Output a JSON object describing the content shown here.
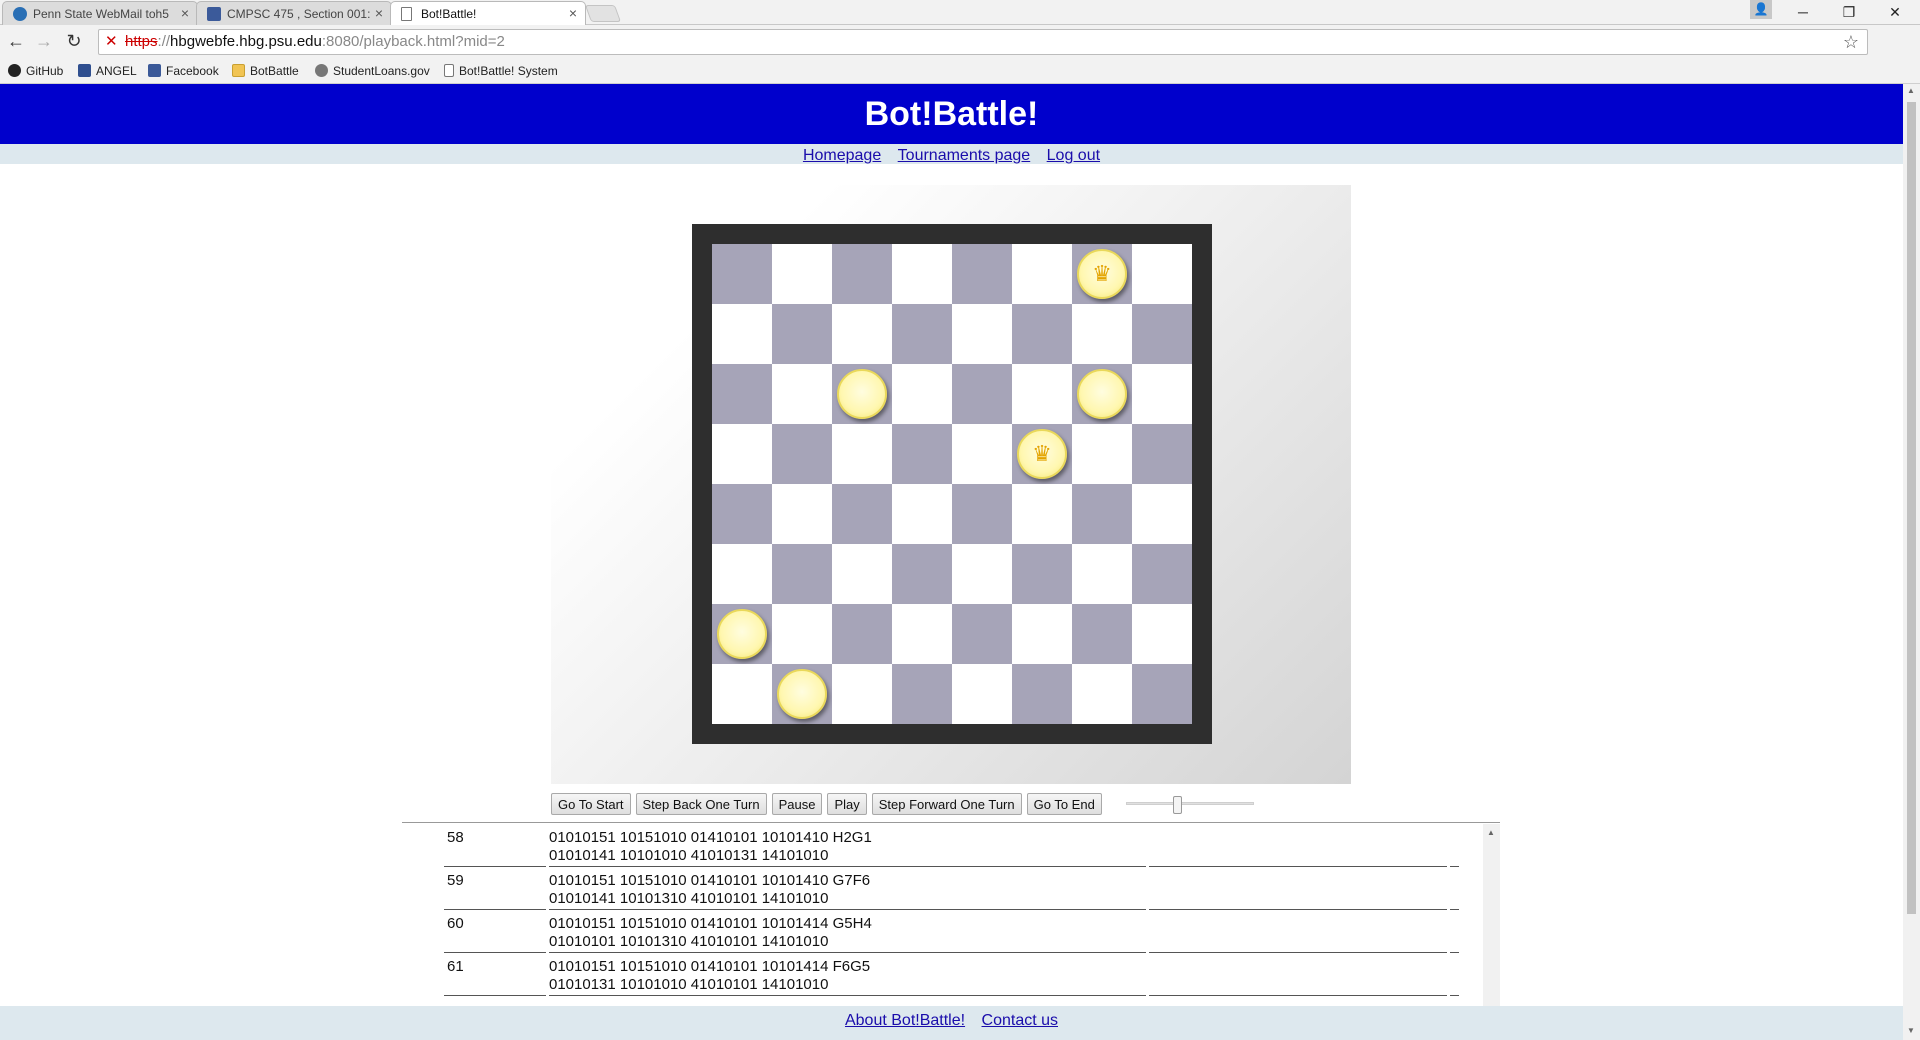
{
  "browser": {
    "tabs": [
      {
        "title": "Penn State WebMail toh5",
        "close": "×"
      },
      {
        "title": "CMPSC 475 , Section 001:",
        "close": "×"
      },
      {
        "title": "Bot!Battle!",
        "close": "×"
      }
    ],
    "url": {
      "scheme": "https",
      "host": "hbgwebfe.hbg.psu.edu",
      "rest": ":8080/playback.html?mid=2"
    },
    "bookmarks": [
      "GitHub",
      "ANGEL",
      "Facebook",
      "BotBattle",
      "StudentLoans.gov",
      "Bot!Battle! System"
    ],
    "nav": {
      "back": "←",
      "forward": "→",
      "reload": "↻",
      "star": "☆",
      "menu": "≡",
      "insecure": "✕"
    },
    "window": {
      "minimize": "─",
      "restore": "❐",
      "close": "✕",
      "profile": "👤"
    }
  },
  "site": {
    "title": "Bot!Battle!",
    "links": [
      "Homepage",
      "Tournaments page",
      "Log out"
    ]
  },
  "board": {
    "pieces": [
      {
        "row": 0,
        "col": 6,
        "king": true
      },
      {
        "row": 2,
        "col": 2,
        "king": false
      },
      {
        "row": 2,
        "col": 6,
        "king": false
      },
      {
        "row": 3,
        "col": 5,
        "king": true
      },
      {
        "row": 6,
        "col": 0,
        "king": false
      },
      {
        "row": 7,
        "col": 1,
        "king": false
      }
    ],
    "colors": {
      "dark": "#a6a4b8",
      "light": "#ffffff",
      "frame": "#2e2e2e",
      "piece": "#fff7b0"
    },
    "king_icon": "crown-icon"
  },
  "controls": {
    "buttons": [
      "Go To Start",
      "Step Back One Turn",
      "Pause",
      "Play",
      "Step Forward One Turn",
      "Go To End"
    ],
    "speed": 0.4
  },
  "moves": [
    {
      "turn": "58",
      "line1": "01010151 10151010 01410101 10101410 H2G1",
      "line2": "01010141 10101010 41010131 14101010"
    },
    {
      "turn": "59",
      "line1": "01010151 10151010 01410101 10101410 G7F6",
      "line2": "01010141 10101310 41010101 14101010"
    },
    {
      "turn": "60",
      "line1": "01010151 10151010 01410101 10101414 G5H4",
      "line2": "01010101 10101310 41010101 14101010"
    },
    {
      "turn": "61",
      "line1": "01010151 10151010 01410101 10101414 F6G5",
      "line2": "01010131 10101010 41010101 14101010"
    }
  ],
  "footer": {
    "links": [
      "About Bot!Battle!",
      "Contact us"
    ]
  }
}
